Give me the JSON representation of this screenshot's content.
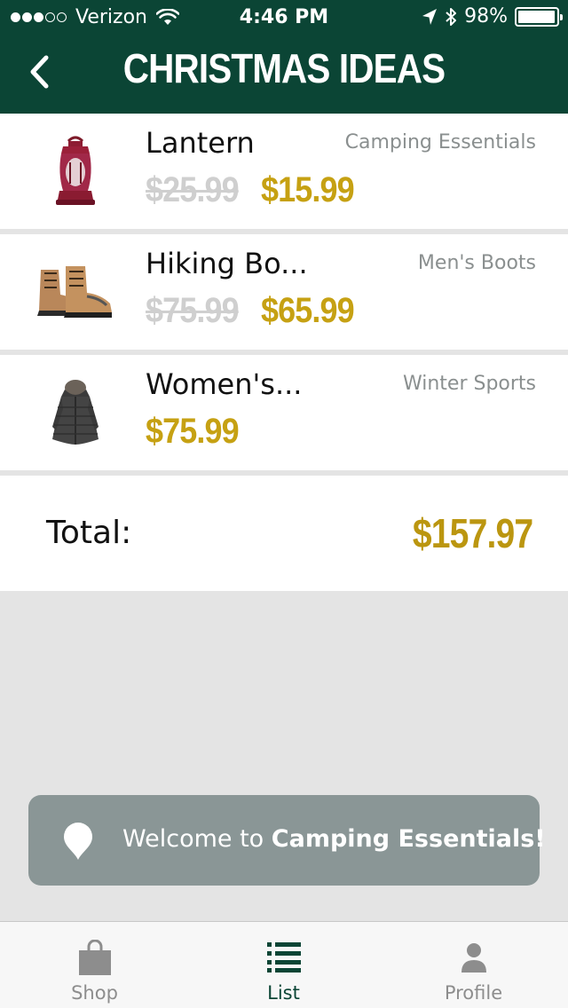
{
  "status_bar": {
    "carrier": "Verizon",
    "time": "4:46 PM",
    "battery": "98%",
    "battery_level": 0.98
  },
  "nav": {
    "title": "CHRISTMAS IDEAS"
  },
  "items": [
    {
      "name": "Lantern",
      "category": "Camping Essentials",
      "old_price": "$25.99",
      "price": "$15.99",
      "icon": "lantern-icon"
    },
    {
      "name": "Hiking Bo...",
      "category": "Men's Boots",
      "old_price": "$75.99",
      "price": "$65.99",
      "icon": "hiking-boots-icon"
    },
    {
      "name": "Women's...",
      "category": "Winter Sports",
      "old_price": "",
      "price": "$75.99",
      "icon": "winter-coat-icon"
    }
  ],
  "total": {
    "label": "Total:",
    "value": "$157.97"
  },
  "toast": {
    "prefix": "Welcome to ",
    "highlight": "Camping Essentials!"
  },
  "tabs": [
    {
      "label": "Shop",
      "icon": "shopping-bag-icon",
      "active": false
    },
    {
      "label": "List",
      "icon": "list-icon",
      "active": true
    },
    {
      "label": "Profile",
      "icon": "person-icon",
      "active": false
    }
  ],
  "colors": {
    "header": "#0b4535",
    "price": "#c6a113",
    "toast": "#8a9696"
  }
}
